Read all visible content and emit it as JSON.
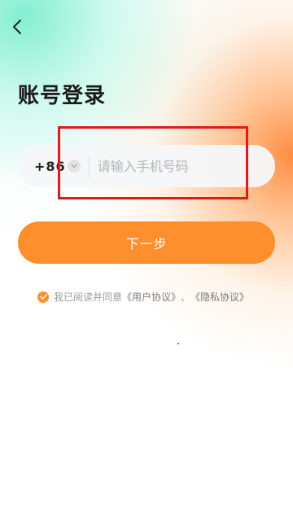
{
  "header": {
    "back_icon": "chevron-left-icon",
    "title": "账号登录"
  },
  "phone": {
    "country_code": "+86",
    "dropdown_icon": "chevron-down-icon",
    "placeholder": "请输入手机号码",
    "value": ""
  },
  "actions": {
    "next_label": "下一步"
  },
  "agreement": {
    "checked": true,
    "check_icon": "check-circle-icon",
    "prefix": "我已阅读并同意",
    "user_agreement": "《用户协议》",
    "separator": "、",
    "privacy_policy": "《隐私协议》"
  },
  "colors": {
    "accent": "#ff8f2c",
    "highlight": "#e01919",
    "title": "#1a1a1a"
  }
}
